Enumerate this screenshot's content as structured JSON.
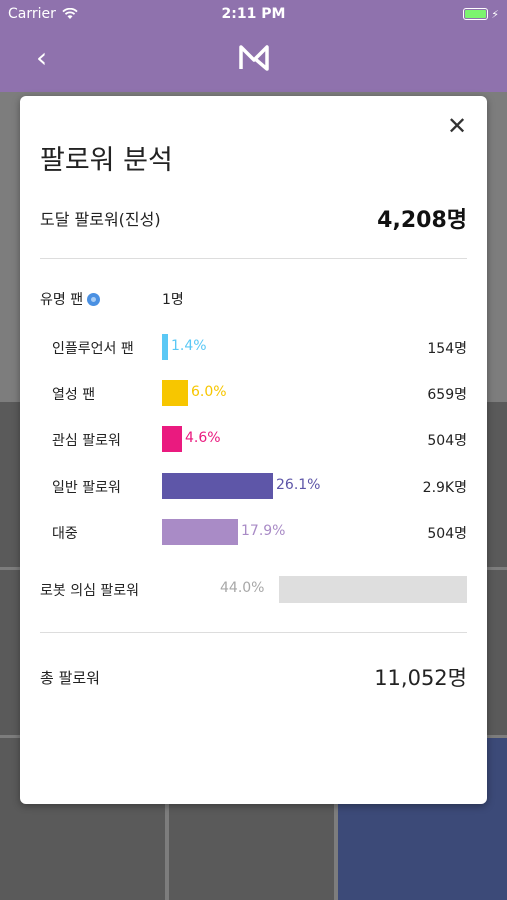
{
  "status_bar": {
    "carrier": "Carrier",
    "time": "2:11 PM"
  },
  "nav": {
    "back_icon": "chevron-left-icon",
    "logo_icon": "app-logo-icon"
  },
  "modal": {
    "title": "팔로워 분석",
    "close_icon": "close-icon",
    "reach": {
      "label": "도달 팔로워(진성)",
      "value": "4,208명"
    },
    "famous_fan": {
      "label": "유명 팬",
      "value": "1명",
      "badge_icon": "verified-badge-icon"
    },
    "breakdown": [
      {
        "label": "인플루언서 팬",
        "percent": "1.4%",
        "count": "154명",
        "value": 1.4,
        "color": "#5ac8f5"
      },
      {
        "label": "열성 팬",
        "percent": "6.0%",
        "count": "659명",
        "value": 6.0,
        "color": "#f7c600"
      },
      {
        "label": "관심 팔로워",
        "percent": "4.6%",
        "count": "504명",
        "value": 4.6,
        "color": "#ea1a7f"
      },
      {
        "label": "일반 팔로워",
        "percent": "26.1%",
        "count": "2.9K명",
        "value": 26.1,
        "color": "#5e56a8"
      },
      {
        "label": "대중",
        "percent": "17.9%",
        "count": "504명",
        "value": 17.9,
        "color": "#a98bc6"
      }
    ],
    "robot": {
      "label": "로봇 의심 팔로워",
      "percent": "44.0%",
      "value": 44.0,
      "color": "#dedede"
    },
    "total": {
      "label": "총 팔로워",
      "value": "11,052명"
    }
  }
}
